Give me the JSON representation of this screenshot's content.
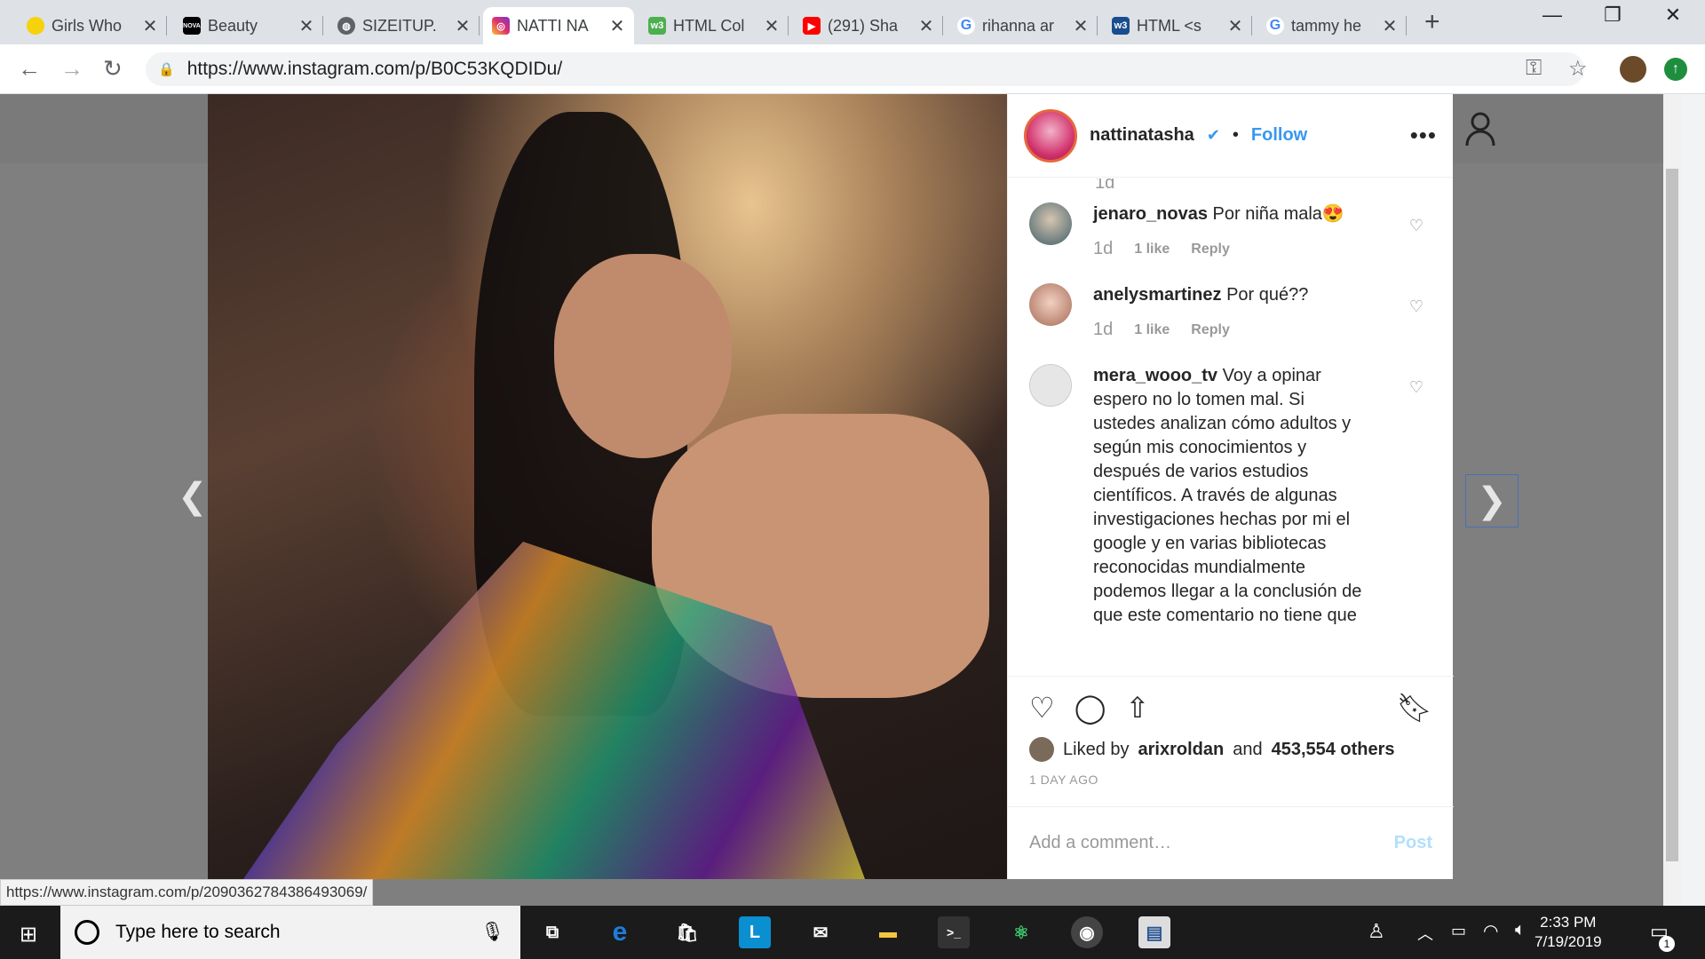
{
  "browser": {
    "tabs": [
      {
        "title": "Girls Who",
        "icon": "yellow-leaf"
      },
      {
        "title": "Beauty",
        "icon": "nova-logo"
      },
      {
        "title": "SIZEITUP.",
        "icon": "globe"
      },
      {
        "title": "NATTI NA",
        "icon": "instagram",
        "active": true
      },
      {
        "title": "HTML Col",
        "icon": "w3-logo"
      },
      {
        "title": "(291) Sha",
        "icon": "youtube"
      },
      {
        "title": "rihanna ar",
        "icon": "google"
      },
      {
        "title": "HTML <s",
        "icon": "w3-logo"
      },
      {
        "title": "tammy he",
        "icon": "google"
      }
    ],
    "url": "https://www.instagram.com/p/B0C53KQDIDu/",
    "status_url": "https://www.instagram.com/p/2090362784386493069/"
  },
  "post": {
    "username": "nattinatasha",
    "follow_label": "Follow",
    "comments": [
      {
        "user": "jenaro_novas",
        "text": "Por niña mala😍",
        "time": "1d",
        "likes": "1 like",
        "reply": "Reply"
      },
      {
        "user": "anelysmartinez",
        "text": "Por qué??",
        "time": "1d",
        "likes": "1 like",
        "reply": "Reply"
      },
      {
        "user": "mera_wooo_tv",
        "text": "Voy a opinar espero no lo tomen mal. Si ustedes analizan cómo adultos y según mis conocimientos y después de varios estudios científicos. A través de algunas investigaciones hechas por mi el google y en varias bibliotecas reconocidas mundialmente podemos llegar a la conclusión de que este comentario no tiene que"
      }
    ],
    "top_time": "1d",
    "liked_by_prefix": "Liked by",
    "liked_by_user": "arixroldan",
    "liked_by_and": "and",
    "liked_by_others": "453,554 others",
    "age": "1 DAY AGO",
    "add_comment_placeholder": "Add a comment…",
    "post_label": "Post"
  },
  "taskbar": {
    "search_placeholder": "Type here to search",
    "time": "2:33 PM",
    "date": "7/19/2019",
    "notification_count": "1"
  }
}
